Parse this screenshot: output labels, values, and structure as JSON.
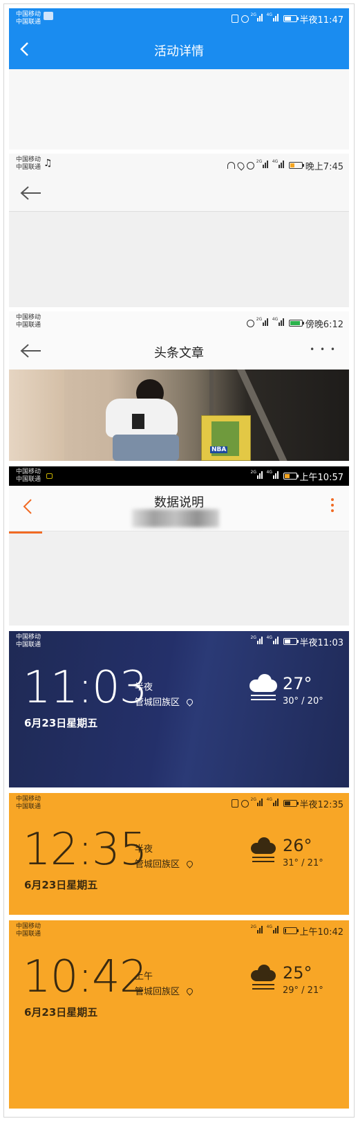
{
  "panel1": {
    "carrier": [
      "中国移动",
      "中国联通"
    ],
    "time": "半夜11:47",
    "title": "活动详情",
    "colors": {
      "bar": "#1a8cf0"
    }
  },
  "panel2": {
    "carrier": [
      "中国移动",
      "中国联通"
    ],
    "time": "晚上7:45"
  },
  "panel3": {
    "carrier": [
      "中国移动",
      "中国联通"
    ],
    "time": "傍晚6:12",
    "title": "头条文章",
    "more": "• • •",
    "photo_text": "NBA"
  },
  "panel4": {
    "carrier": [
      "中国移动",
      "中国联通"
    ],
    "time": "上午10:57",
    "title": "数据说明",
    "accent": "#f06a23"
  },
  "panel5": {
    "carrier": [
      "中国移动",
      "中国联通"
    ],
    "time": "半夜11:03",
    "clock": "11:03",
    "period": "半夜",
    "location": "管城回族区",
    "date": "6月23日星期五",
    "temp": "27°",
    "range": "30° / 20°"
  },
  "panel6": {
    "carrier": [
      "中国移动",
      "中国联通"
    ],
    "time": "半夜12:35",
    "clock": "12:35",
    "period": "半夜",
    "location": "管城回族区",
    "date": "6月23日星期五",
    "temp": "26°",
    "range": "31° / 21°"
  },
  "panel7": {
    "carrier": [
      "中国移动",
      "中国联通"
    ],
    "time": "上午10:42",
    "clock": "10:42",
    "period": "上午",
    "location": "管城回族区",
    "date": "6月23日星期五",
    "temp": "25°",
    "range": "29° / 21°"
  },
  "network": {
    "g2": "2G",
    "g4": "4G"
  }
}
